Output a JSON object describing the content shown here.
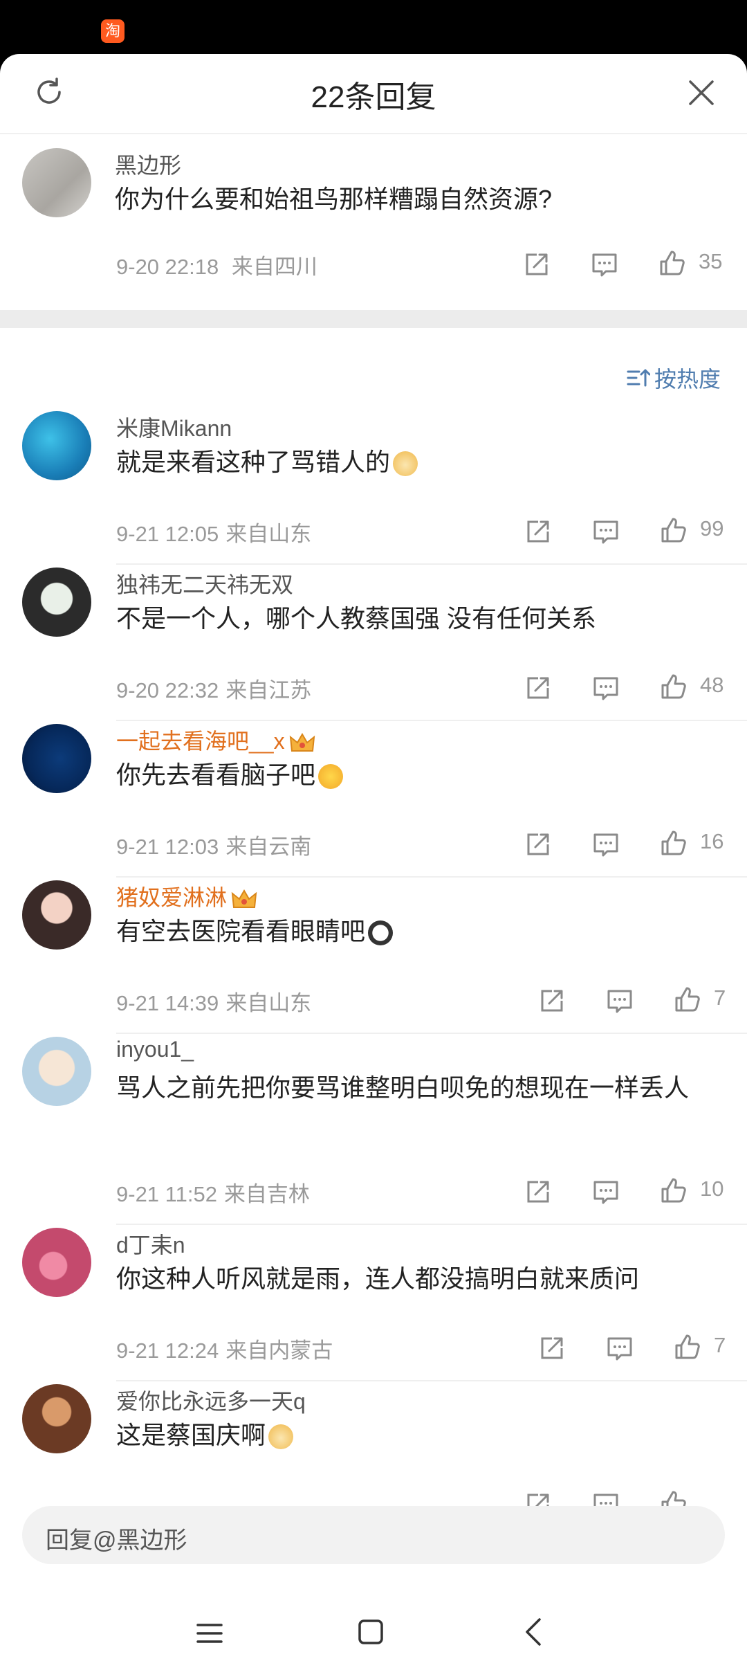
{
  "header": {
    "title": "22条回复"
  },
  "root_comment": {
    "user": "黑边形",
    "text": "你为什么要和始祖鸟那样糟蹋自然资源?",
    "time": "9-20 22:18",
    "location": "来自四川",
    "likes": "35"
  },
  "sort": {
    "label": "按热度"
  },
  "replies": [
    {
      "user": "米康Mikann",
      "vip": false,
      "text": "就是来看这种了骂错人的",
      "emoji": "doge",
      "time": "9-21 12:05",
      "location": "来自山东",
      "likes": "99"
    },
    {
      "user": "独祎无二天祎无双",
      "vip": false,
      "text": "不是一个人，哪个人教蔡国强 没有任何关系",
      "emoji": "",
      "time": "9-20 22:32",
      "location": "来自江苏",
      "likes": "48"
    },
    {
      "user": "一起去看海吧__x",
      "vip": true,
      "text": "你先去看看脑子吧",
      "emoji": "laugh-cry",
      "time": "9-21 12:03",
      "location": "来自云南",
      "likes": "16"
    },
    {
      "user": "猪奴爱淋淋",
      "vip": true,
      "text": "有空去医院看看眼睛吧",
      "emoji": "panda",
      "time": "9-21 14:39",
      "location": "来自山东",
      "likes": "7"
    },
    {
      "user": "inyou1_",
      "vip": false,
      "text": "骂人之前先把你要骂谁整明白呗免的想现在一样丢人",
      "emoji": "",
      "time": "9-21 11:52",
      "location": "来自吉林",
      "likes": "10"
    },
    {
      "user": "d丁耒n",
      "vip": false,
      "text": "你这种人听风就是雨，连人都没搞明白就来质问",
      "emoji": "",
      "time": "9-21 12:24",
      "location": "来自内蒙古",
      "likes": "7"
    },
    {
      "user": "爱你比永远多一天q",
      "vip": false,
      "text": "这是蔡国庆啊",
      "emoji": "doge",
      "time": "",
      "location": "",
      "likes": ""
    }
  ],
  "input": {
    "placeholder": "回复@黑边形"
  },
  "colors": {
    "vip_name": "#e1701e",
    "sort_blue": "#507daf",
    "meta_gray": "#9a9a9a"
  }
}
